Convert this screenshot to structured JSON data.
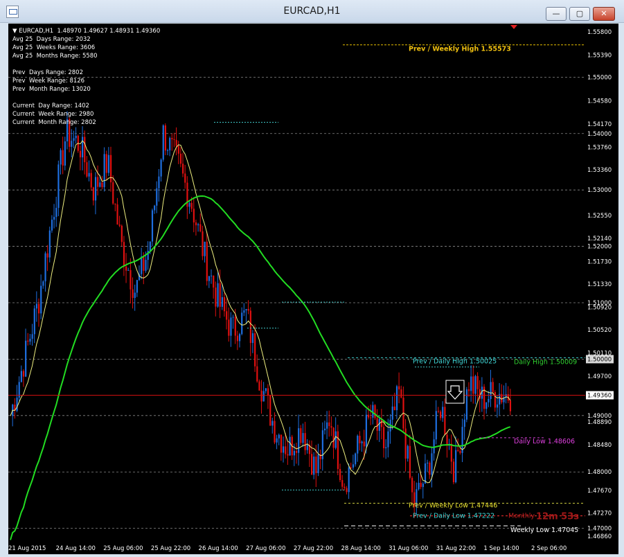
{
  "window": {
    "title": "EURCAD,H1",
    "min_label": "—",
    "max_label": "▢",
    "close_label": "✕"
  },
  "header": {
    "line": "EURCAD,H1  1.48970 1.49627 1.48931 1.49360"
  },
  "stats": {
    "avg_days": "Avg 25  Days Range: 2032",
    "avg_weeks": "Avg 25  Weeks Range: 3606",
    "avg_months": "Avg 25  Months Range: 5580",
    "prev_days": "Prev  Days Range: 2802",
    "prev_week": "Prev  Week Range: 8126",
    "prev_month": "Prev  Month Range: 13020",
    "cur_day": "Current  Day Range: 1402",
    "cur_week": "Current  Week Range: 2980",
    "cur_month": "Current  Month Range: 2802"
  },
  "levels": {
    "prev_weekly_high": "Prev / Weekly High 1.55573",
    "prev_daily_high": "Prev / Daily High 1.50025",
    "daily_high": "Daily High 1.50009",
    "daily_low": "Daily Low 1.48606",
    "prev_weekly_low": "Prev / Weekly Low 1.47446",
    "prev_daily_low": "Prev / Daily Low 1.47222",
    "monthly": "Monthly",
    "weekly_low": "Weekly Low 1.47045",
    "timer": "12m 53s"
  },
  "price_axis": {
    "labels": [
      "1.55800",
      "1.55390",
      "1.55000",
      "1.54580",
      "1.54170",
      "1.54000",
      "1.53760",
      "1.53360",
      "1.53000",
      "1.52550",
      "1.52140",
      "1.52000",
      "1.51730",
      "1.51330",
      "1.51000",
      "1.50920",
      "1.50520",
      "1.50110",
      "1.50000",
      "1.49700",
      "1.49360",
      "1.49000",
      "1.48890",
      "1.48480",
      "1.48000",
      "1.47670",
      "1.47270",
      "1.47000",
      "1.46860"
    ],
    "current": "1.49360"
  },
  "time_axis": {
    "labels": [
      "21 Aug 2015",
      "24 Aug 14:00",
      "25 Aug 06:00",
      "25 Aug 22:00",
      "26 Aug 14:00",
      "27 Aug 06:00",
      "27 Aug 22:00",
      "28 Aug 14:00",
      "31 Aug 06:00",
      "31 Aug 22:00",
      "1 Sep 14:00",
      "2 Sep 06:00"
    ]
  },
  "colors": {
    "background": "#000000",
    "bull": "#1e6fe0",
    "bear": "#e01010",
    "ma_fast": "#f0f080",
    "ma_slow": "#22dd22",
    "current_line": "#d01010"
  },
  "chart_data": {
    "type": "candlestick",
    "symbol": "EURCAD",
    "timeframe": "H1",
    "ylim": [
      1.4675,
      1.5595
    ],
    "x": [
      "21 Aug 2015",
      "24 Aug 14:00",
      "25 Aug 06:00",
      "25 Aug 22:00",
      "26 Aug 14:00",
      "27 Aug 06:00",
      "27 Aug 22:00",
      "28 Aug 14:00",
      "31 Aug 06:00",
      "31 Aug 22:00",
      "1 Sep 14:00",
      "2 Sep 06:00"
    ],
    "close_path": [
      1.49,
      1.5,
      1.51,
      1.525,
      1.54,
      1.538,
      1.53,
      1.535,
      1.52,
      1.512,
      1.52,
      1.54,
      1.535,
      1.528,
      1.518,
      1.51,
      1.505,
      1.508,
      1.496,
      1.488,
      1.484,
      1.488,
      1.48,
      1.49,
      1.478,
      1.484,
      1.49,
      1.484,
      1.494,
      1.474,
      1.48,
      1.492,
      1.48,
      1.496,
      1.493,
      1.494,
      1.4936
    ],
    "levels": {
      "prev_weekly_high": 1.55573,
      "prev_daily_high": 1.50025,
      "daily_high": 1.50009,
      "daily_low": 1.48606,
      "prev_weekly_low": 1.47446,
      "prev_daily_low": 1.47222,
      "weekly_low": 1.47045,
      "current": 1.4936
    }
  }
}
